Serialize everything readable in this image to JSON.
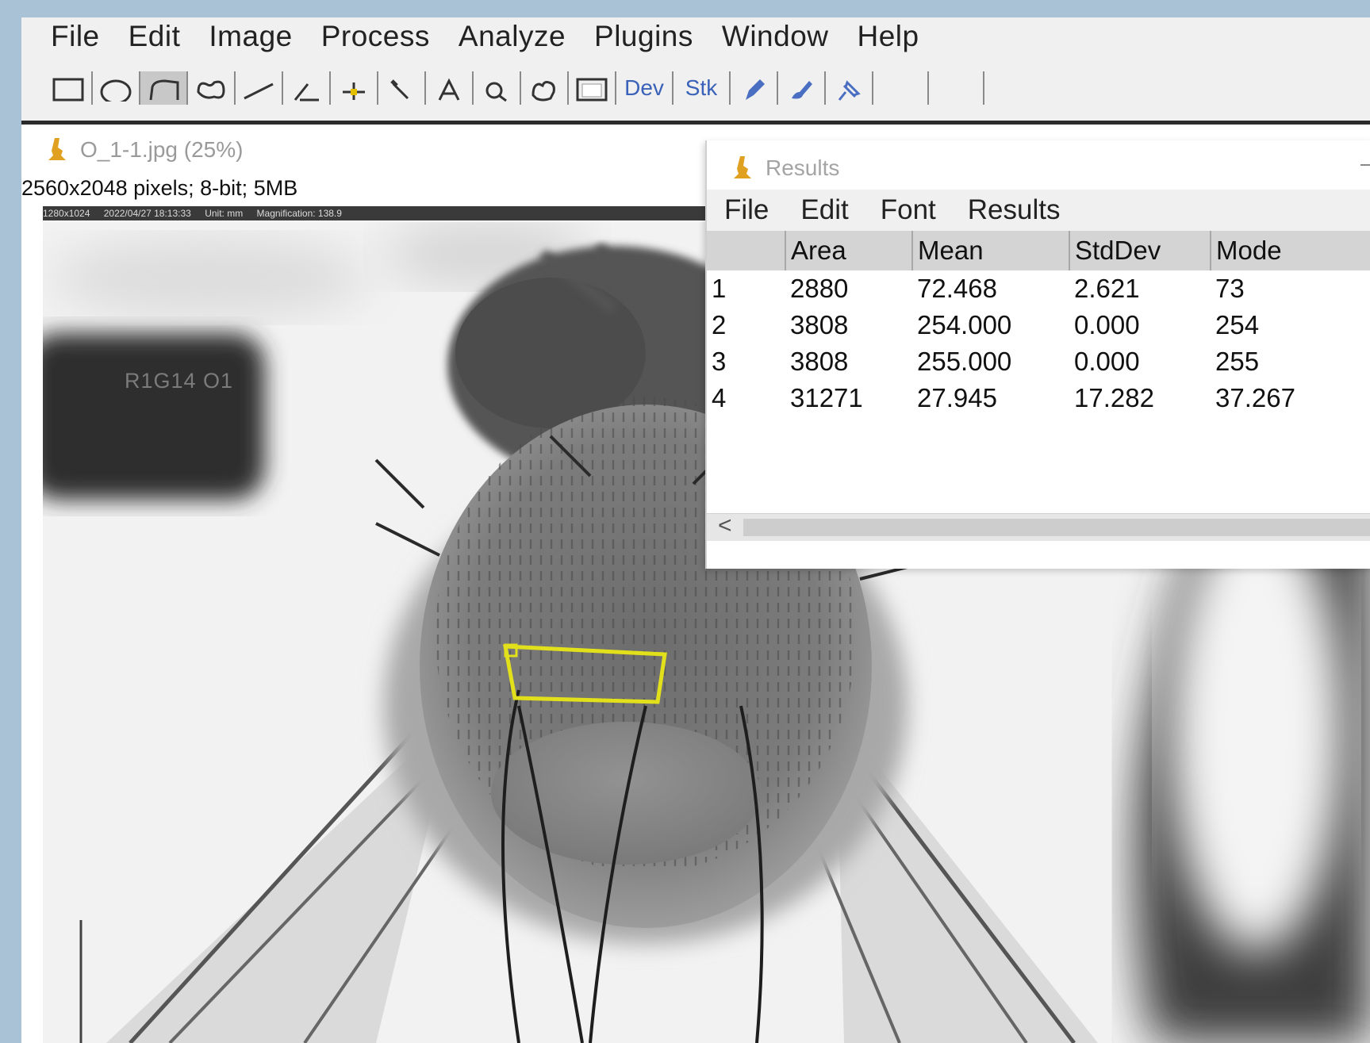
{
  "menubar": {
    "items": [
      "File",
      "Edit",
      "Image",
      "Process",
      "Analyze",
      "Plugins",
      "Window",
      "Help"
    ]
  },
  "toolbar": {
    "tools": [
      {
        "icon": "rectangle-select-icon"
      },
      {
        "icon": "oval-select-icon"
      },
      {
        "icon": "polygon-select-icon",
        "active": true
      },
      {
        "icon": "freehand-select-icon"
      },
      {
        "icon": "line-icon"
      },
      {
        "icon": "angle-icon"
      },
      {
        "icon": "point-icon"
      },
      {
        "icon": "wand-icon"
      },
      {
        "icon": "text-tool-icon"
      },
      {
        "icon": "magnifier-icon"
      },
      {
        "icon": "hand-icon"
      },
      {
        "icon": "color-picker-icon"
      }
    ],
    "dev_label": "Dev",
    "stk_label": "Stk"
  },
  "image_window": {
    "title": "O_1-1.jpg (25%)",
    "info": "2560x2048 pixels; 8-bit; 5MB",
    "strip_texts": [
      "1280x1024",
      "2022/04/27 18:13:33",
      "Unit: mm",
      "Magnification: 138.9"
    ],
    "sample_label": "R1G14 O1",
    "selection_color": "#e2e01a"
  },
  "results_window": {
    "title": "Results",
    "menu": [
      "File",
      "Edit",
      "Font",
      "Results"
    ],
    "columns": [
      "",
      "Area",
      "Mean",
      "StdDev",
      "Mode"
    ],
    "rows": [
      [
        "1",
        "2880",
        "72.468",
        "2.621",
        "73"
      ],
      [
        "2",
        "3808",
        "254.000",
        "0.000",
        "254"
      ],
      [
        "3",
        "3808",
        "255.000",
        "0.000",
        "255"
      ],
      [
        "4",
        "31271",
        "27.945",
        "17.282",
        "37.267"
      ]
    ],
    "scroll_left": "<"
  }
}
